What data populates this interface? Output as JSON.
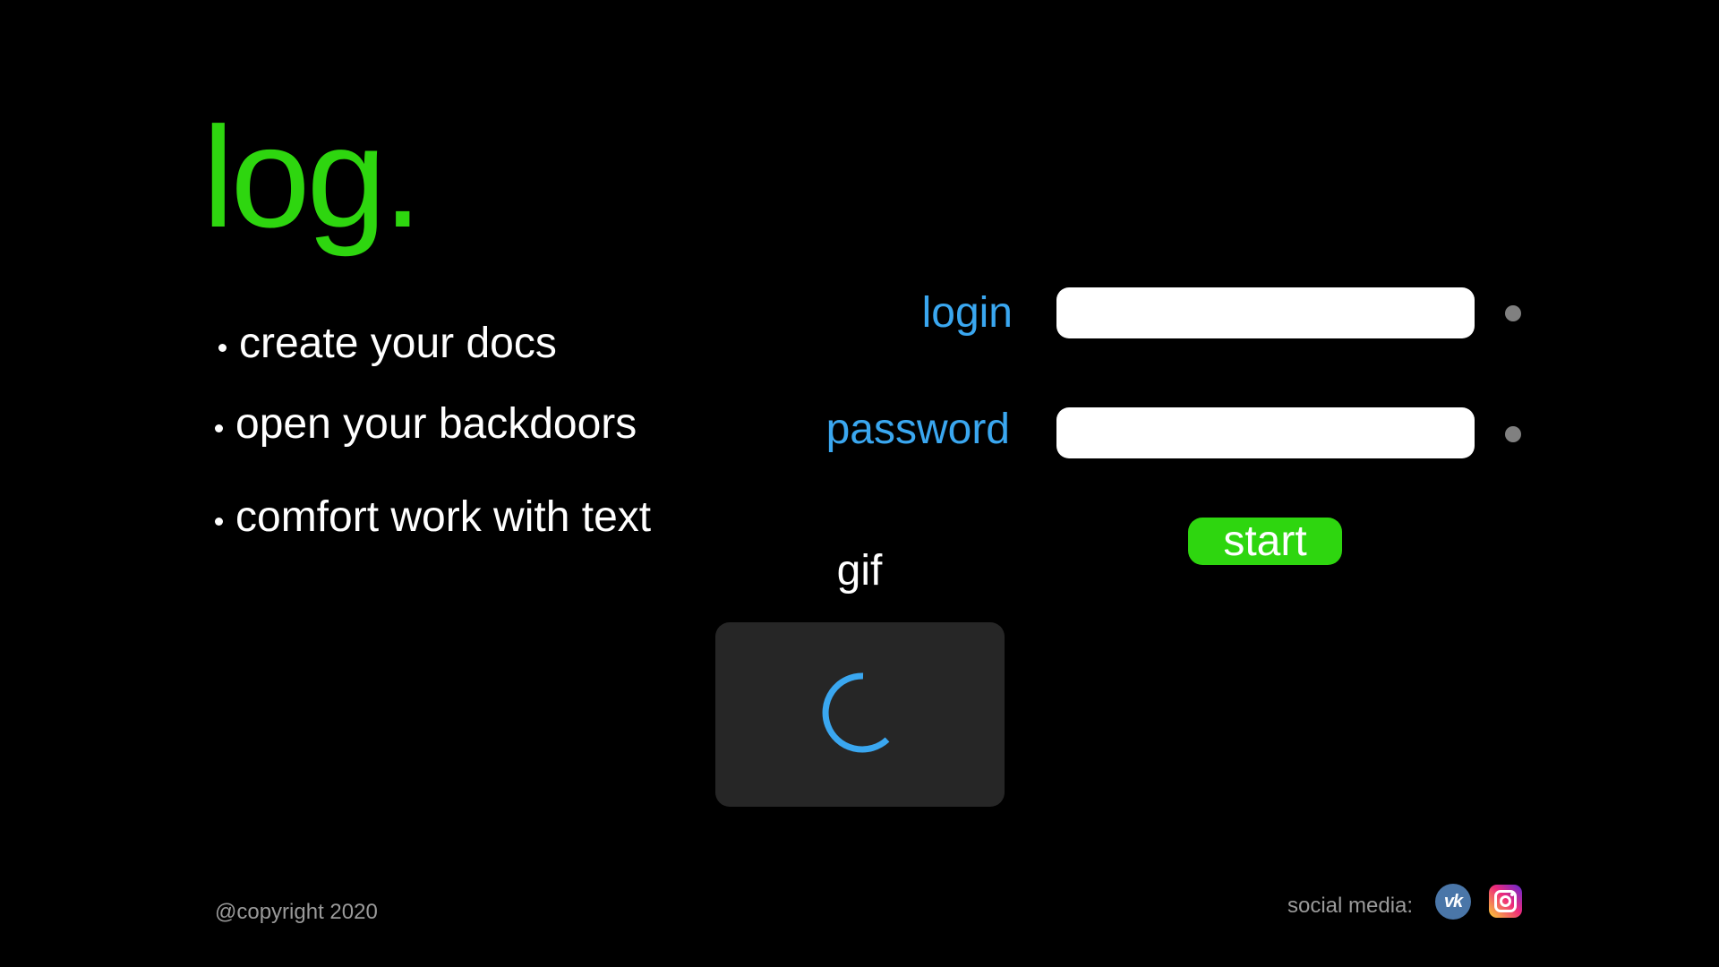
{
  "brand": {
    "logo_text": "log.",
    "color": "#2ed60f"
  },
  "features": [
    {
      "text": "create your docs"
    },
    {
      "text": "open your backdoors"
    },
    {
      "text": "comfort work with text"
    }
  ],
  "form": {
    "label_color": "#3aa7f0",
    "login": {
      "label": "login",
      "value": "",
      "placeholder": ""
    },
    "password": {
      "label": "password",
      "value": "",
      "placeholder": ""
    },
    "indicator_color": "#808080",
    "start_label": "start",
    "start_color": "#2ed60f"
  },
  "gif": {
    "label": "gif",
    "loading_icon": "spinner-icon",
    "spinner_color": "#3aa7f0"
  },
  "footer": {
    "copyright": "@copyright 2020",
    "social_label": "social media:",
    "social": [
      {
        "name": "vk-icon",
        "glyph": "vk",
        "color": "#4a76a8"
      },
      {
        "name": "instagram-icon",
        "color": "#ee2a7b"
      }
    ]
  }
}
